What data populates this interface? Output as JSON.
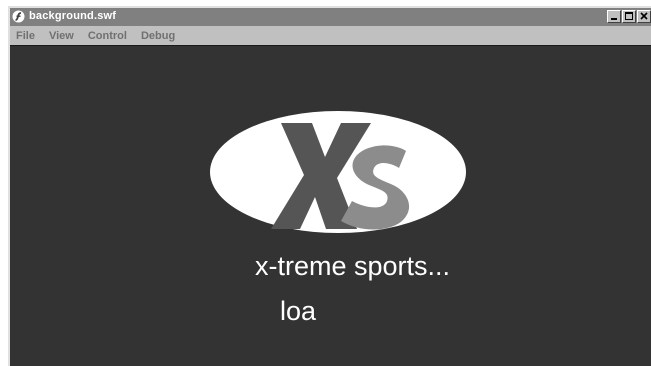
{
  "window": {
    "title": "background.swf",
    "controls": [
      "minimize-button",
      "maximize-button",
      "close-button"
    ]
  },
  "menubar": {
    "items": [
      "File",
      "View",
      "Control",
      "Debug"
    ]
  },
  "stage": {
    "logo_letters": "Xs",
    "tagline": "x-treme sports...",
    "loading_text": "loa"
  },
  "colors": {
    "stage_bg": "#333333",
    "logo_ellipse": "#ffffff",
    "logo_x": "#555555",
    "logo_s": "#888888",
    "titlebar": "#808080"
  }
}
